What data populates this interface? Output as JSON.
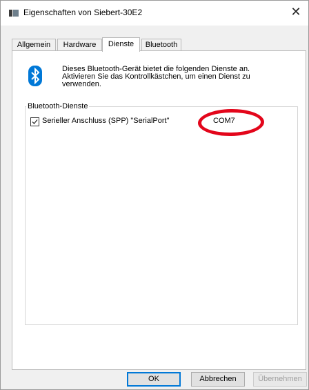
{
  "window": {
    "title": "Eigenschaften von Siebert-30E2",
    "close_glyph": "✕"
  },
  "tabs": [
    {
      "label": "Allgemein",
      "selected": false
    },
    {
      "label": "Hardware",
      "selected": false
    },
    {
      "label": "Dienste",
      "selected": true
    },
    {
      "label": "Bluetooth",
      "selected": false
    }
  ],
  "info": {
    "icon": "bluetooth-icon",
    "line1": "Dieses Bluetooth-Gerät bietet die folgenden Dienste an.",
    "line2": "Aktivieren Sie das Kontrollkästchen, um einen Dienst zu",
    "line3": "verwenden."
  },
  "services": {
    "group_label": "Bluetooth-Dienste",
    "items": [
      {
        "label": "Serieller Anschluss (SPP) \"SerialPort\"",
        "checked": true,
        "port": "COM7"
      }
    ]
  },
  "buttons": {
    "ok": "OK",
    "cancel": "Abbrechen",
    "apply": "Übernehmen"
  },
  "colors": {
    "accent": "#0078d7",
    "highlight": "#e3061b",
    "bluetooth": "#0078d7"
  }
}
